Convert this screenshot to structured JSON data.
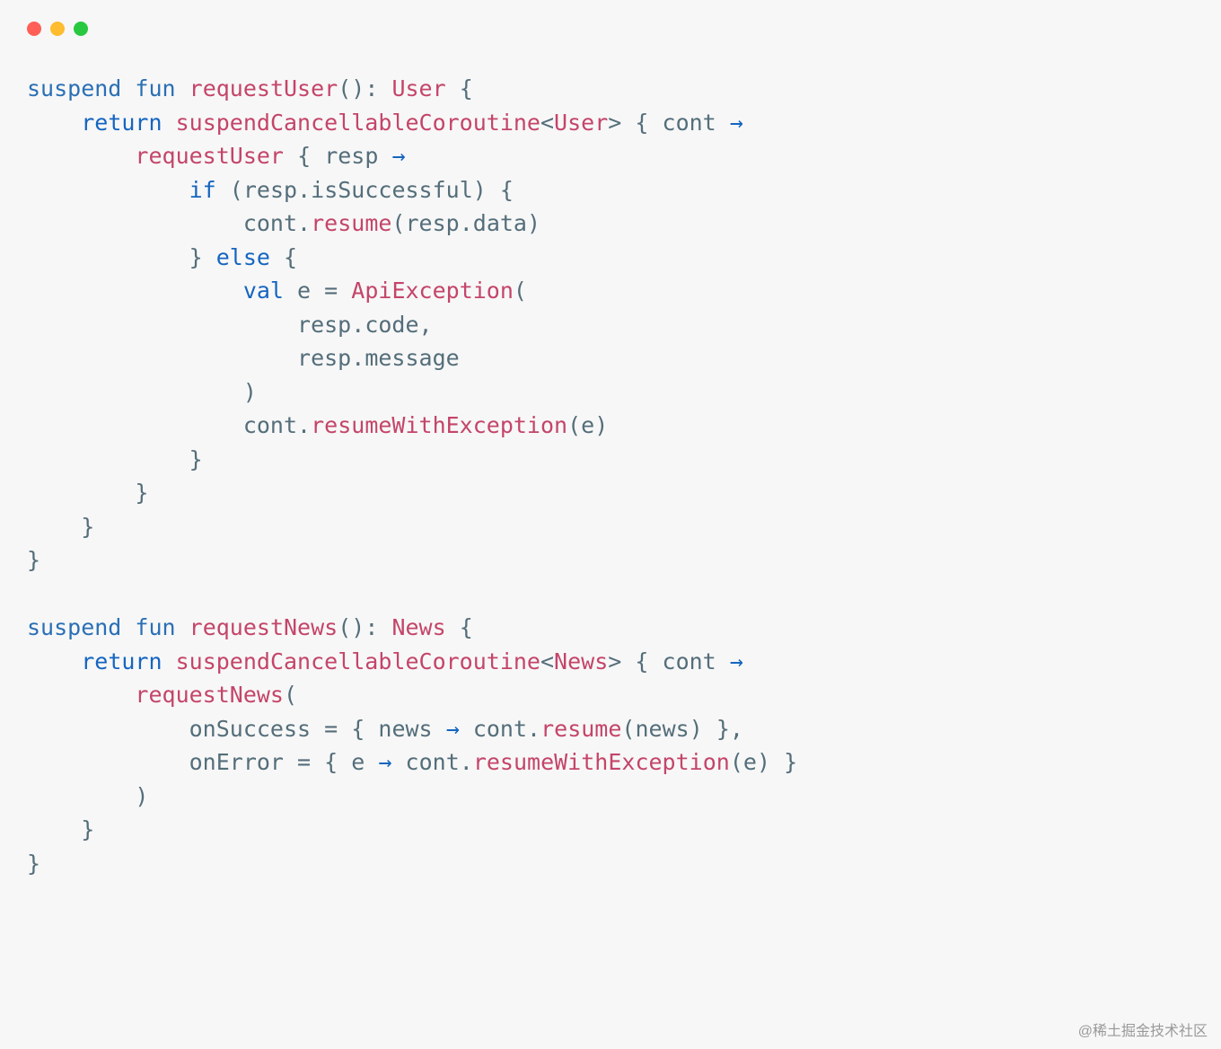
{
  "tokens": {
    "suspend": "suspend",
    "fun": "fun",
    "requestUser": "requestUser",
    "User": "User",
    "return": "return",
    "suspendCancellableCoroutine": "suspendCancellableCoroutine",
    "cont": "cont",
    "resp": "resp",
    "if": "if",
    "isSuccessful": "isSuccessful",
    "resume": "resume",
    "data": "data",
    "else": "else",
    "val": "val",
    "e": "e",
    "ApiException": "ApiException",
    "code": "code",
    "message": "message",
    "resumeWithException": "resumeWithException",
    "requestNews": "requestNews",
    "News": "News",
    "onSuccess": "onSuccess",
    "onError": "onError",
    "news": "news",
    "arrow": "→",
    "eq": "="
  },
  "watermark": "@稀土掘金技术社区"
}
